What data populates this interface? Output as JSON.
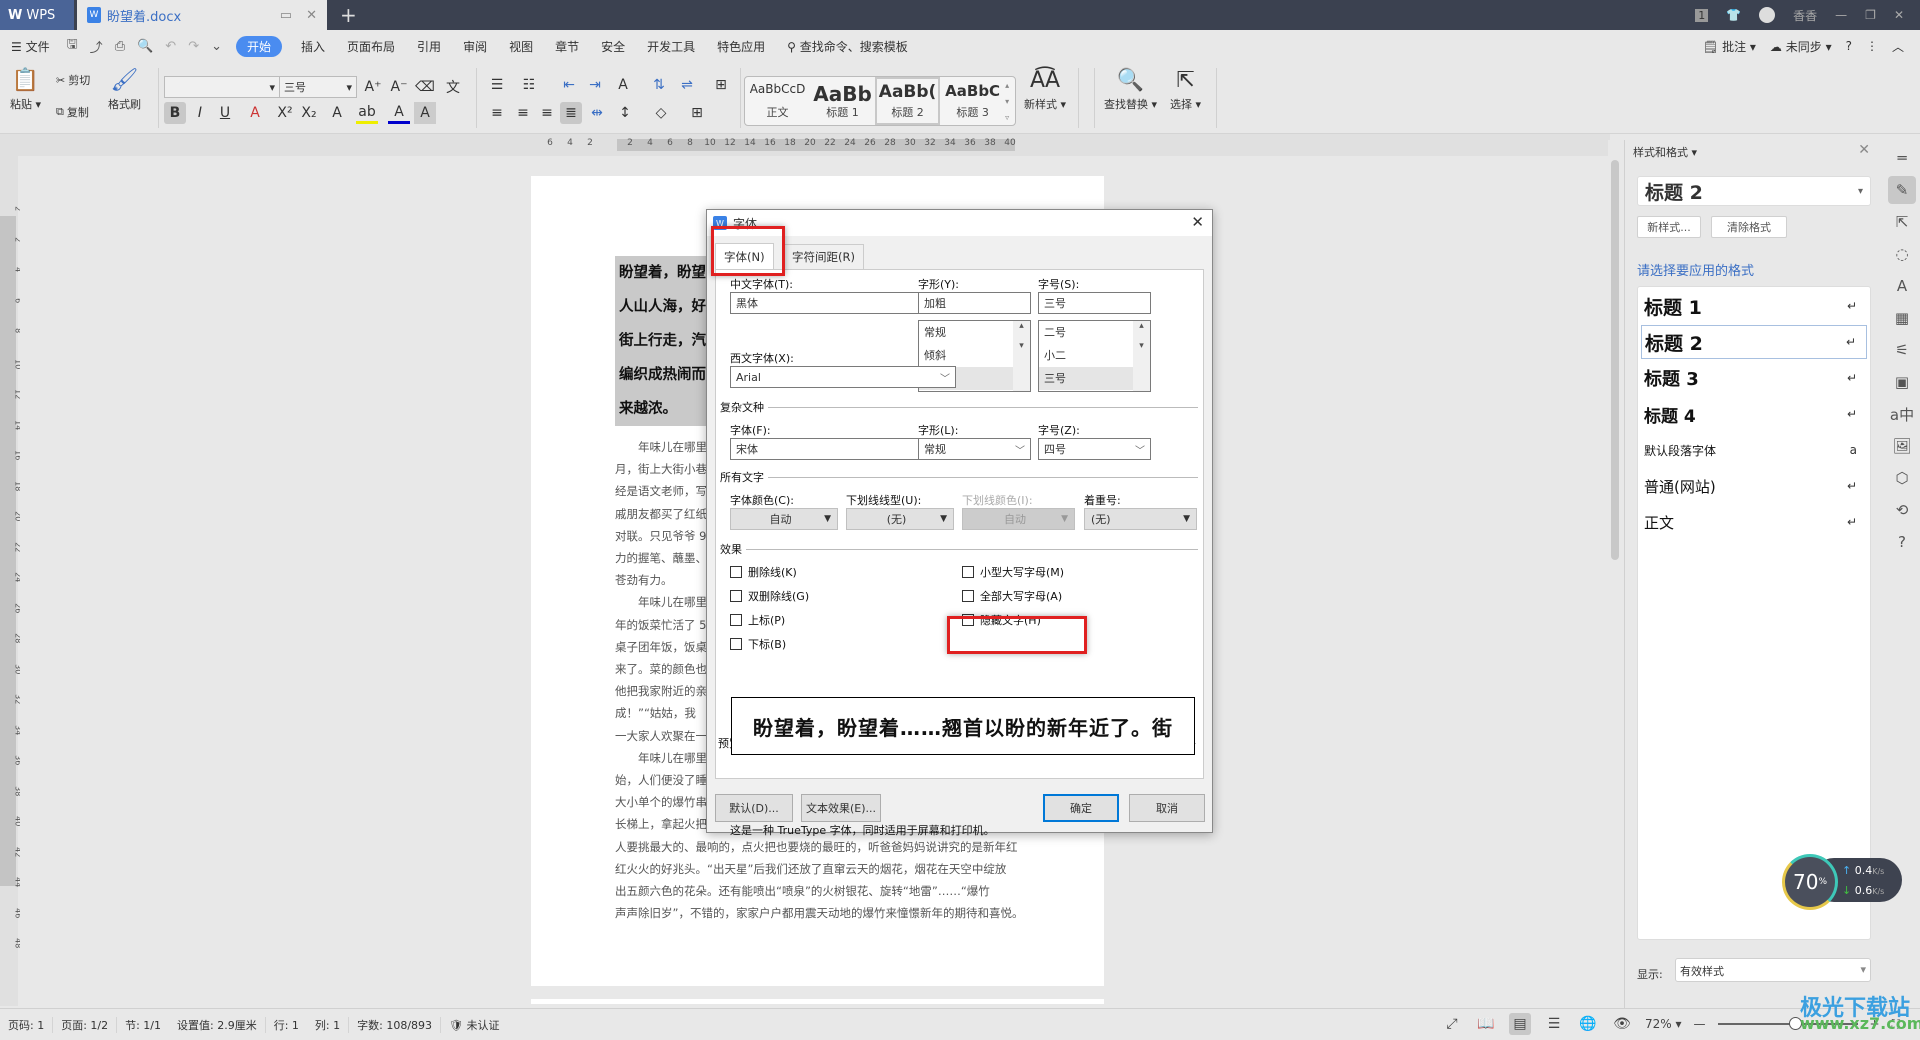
{
  "titlebar": {
    "app_tab": "WPS",
    "doc_tab": "盼望着.docx",
    "new_tab": "+",
    "notification_count": "1",
    "user_name": "香香"
  },
  "menubar": {
    "file": "文件",
    "items": [
      "开始",
      "插入",
      "页面布局",
      "引用",
      "审阅",
      "视图",
      "章节",
      "安全",
      "开发工具",
      "特色应用"
    ],
    "active": "开始",
    "search": "查找命令、搜索模板",
    "right": {
      "comment": "批注",
      "sync": "未同步",
      "help": "?"
    }
  },
  "ribbon": {
    "paste": "粘贴",
    "cut": "剪切",
    "copy": "复制",
    "format_painter": "格式刷",
    "font_name": "",
    "font_size": "三号",
    "styles": [
      {
        "preview": "AaBbCcD",
        "label": "正文"
      },
      {
        "preview": "AaBb",
        "label": "标题 1"
      },
      {
        "preview": "AaBb(",
        "label": "标题 2",
        "selected": true
      },
      {
        "preview": "AaBbC",
        "label": "标题 3"
      }
    ],
    "new_style": "新样式",
    "find_replace": "查找替换",
    "select": "选择"
  },
  "ruler": {
    "h_ticks": [
      "6",
      "4",
      "2",
      "",
      "2",
      "4",
      "6",
      "8",
      "10",
      "12",
      "14",
      "16",
      "18",
      "20",
      "22",
      "24",
      "26",
      "28",
      "30",
      "32",
      "34",
      "36",
      "38",
      "40"
    ],
    "v_ticks": [
      "2",
      "2",
      "4",
      "6",
      "8",
      "10",
      "12",
      "14",
      "16",
      "18",
      "20",
      "22",
      "24",
      "26",
      "28",
      "30",
      "32",
      "34",
      "36",
      "38",
      "40",
      "42",
      "44",
      "46",
      "48"
    ]
  },
  "document": {
    "heading_lines": [
      "盼望着，盼望着",
      "人山人海，好",
      "街上行走，汽",
      "编织成热闹而",
      "来越浓。"
    ],
    "body_lines": [
      {
        "indent": true,
        "text": "年味儿在哪里"
      },
      {
        "text": "月，街上大街小巷"
      },
      {
        "text": "经是语文老师，写"
      },
      {
        "text": "戚朋友都买了红纸"
      },
      {
        "text": "对联。只见爷爷 9"
      },
      {
        "text": "力的握笔、蘸墨、"
      },
      {
        "text": "苍劲有力。"
      },
      {
        "indent": true,
        "text": "年味儿在哪里"
      },
      {
        "text": "年的饭菜忙活了 5"
      },
      {
        "text": "桌子团年饭，饭桌"
      },
      {
        "text": "来了。菜的颜色也"
      },
      {
        "text": "他把我家附近的亲"
      },
      {
        "text": "成！”“姑姑，我"
      },
      {
        "text": "一大家人欢聚在一"
      },
      {
        "indent": true,
        "text": "年味儿在哪里"
      },
      {
        "text": "始，人们便没了睡"
      },
      {
        "text": "大小单个的爆竹串"
      },
      {
        "text": "长梯上，拿起火把"
      },
      {
        "text": "人要挑最大的、最响的，点火把也要烧的最旺的，听爸爸妈妈说讲究的是新年红"
      },
      {
        "text": "红火火的好兆头。“出天星”后我们还放了直窜云天的烟花，烟花在天空中绽放"
      },
      {
        "text": "出五颜六色的花朵。还有能喷出“喷泉”的火树银花、旋转“地雷”……“爆竹"
      },
      {
        "text": "声声除旧岁”，不错的，家家户户都用震天动地的爆竹来憧憬新年的期待和喜悦。"
      }
    ]
  },
  "dialog": {
    "title": "字体",
    "tabs": [
      "字体(N)",
      "字符间距(R)"
    ],
    "active_tab": "字体(N)",
    "chinese_font_label": "中文字体(T):",
    "chinese_font": "黑体",
    "style_label": "字形(Y):",
    "style_value": "加粗",
    "style_options": [
      "常规",
      "倾斜",
      "加粗"
    ],
    "size_label": "字号(S):",
    "size_value": "三号",
    "size_options": [
      "二号",
      "小二",
      "三号"
    ],
    "western_font_label": "西文字体(X):",
    "western_font": "Arial",
    "complex_group": "复杂文种",
    "complex_font_label": "字体(F):",
    "complex_font": "宋体",
    "complex_style_label": "字形(L):",
    "complex_style": "常规",
    "complex_size_label": "字号(Z):",
    "complex_size": "四号",
    "all_text_group": "所有文字",
    "font_color_label": "字体颜色(C):",
    "font_color": "自动",
    "underline_type_label": "下划线线型(U):",
    "underline_type": "(无)",
    "underline_color_label": "下划线颜色(I):",
    "underline_color": "自动",
    "emphasis_label": "着重号:",
    "emphasis": "(无)",
    "effects_group": "效果",
    "effects_left": [
      {
        "label": "删除线(K)",
        "checked": false
      },
      {
        "label": "双删除线(G)",
        "checked": false
      },
      {
        "label": "上标(P)",
        "checked": false
      },
      {
        "label": "下标(B)",
        "checked": false
      }
    ],
    "effects_right": [
      {
        "label": "小型大写字母(M)",
        "checked": false
      },
      {
        "label": "全部大写字母(A)",
        "checked": false
      },
      {
        "label": "隐藏文字(H)",
        "checked": false
      }
    ],
    "preview_group": "预览",
    "preview_text": "盼望着，盼望着……翘首以盼的新年近了。街",
    "truetype_note": "这是一种 TrueType 字体，同时适用于屏幕和打印机。",
    "buttons": {
      "default": "默认(D)...",
      "text_effects": "文本效果(E)...",
      "ok": "确定",
      "cancel": "取消"
    }
  },
  "panel": {
    "title": "样式和格式",
    "current_style": "标题  2",
    "new_style": "新样式...",
    "clear_format": "清除格式",
    "hint": "请选择要应用的格式",
    "styles": [
      {
        "label": "标题  1",
        "mark": "↵",
        "kind": "h1"
      },
      {
        "label": "标题  2",
        "mark": "↵",
        "kind": "h2",
        "selected": true
      },
      {
        "label": "标题  3",
        "mark": "↵",
        "kind": "h3"
      },
      {
        "label": "标题  4",
        "mark": "↵",
        "kind": "h4"
      },
      {
        "label": "默认段落字体",
        "mark": "a",
        "kind": "p"
      },
      {
        "label": "普通(网站)",
        "mark": "↵",
        "kind": "n"
      },
      {
        "label": "正文",
        "mark": "↵",
        "kind": "n"
      }
    ],
    "show_label": "显示:",
    "show_value": "有效样式"
  },
  "network_widget": {
    "percent": "70",
    "unit": "%",
    "up": "0.4",
    "down": "0.6",
    "rate_unit": "K/s"
  },
  "status": {
    "page_num": "页码: 1",
    "pages": "页面: 1/2",
    "section": "节: 1/1",
    "setting": "设置值: 2.9厘米",
    "row": "行: 1",
    "col": "列: 1",
    "word_count": "字数: 108/893",
    "cert": "未认证",
    "zoom": "72%",
    "zoom_fraction": 0.72
  },
  "watermark": {
    "name": "极光下载站",
    "url": "www.xz7.com"
  }
}
